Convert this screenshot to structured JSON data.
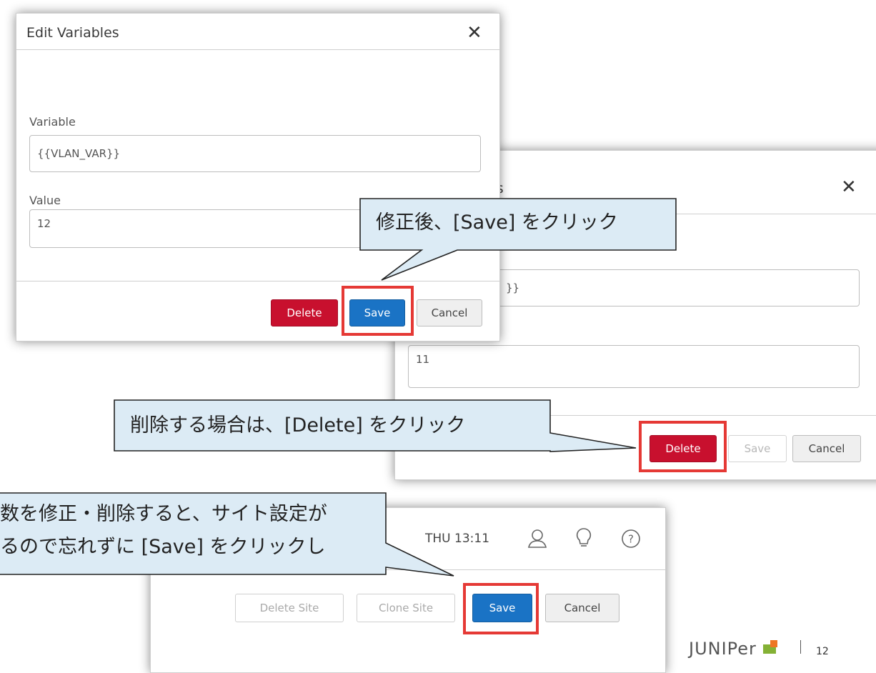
{
  "dialog_back": {
    "title_partial": "es",
    "variable_value_partial": "}}",
    "value": "11",
    "buttons": {
      "delete": "Delete",
      "save": "Save",
      "cancel": "Cancel"
    }
  },
  "dialog_front": {
    "title": "Edit Variables",
    "variable_label": "Variable",
    "variable_value": "{{VLAN_VAR}}",
    "value_label": "Value",
    "value": "12",
    "buttons": {
      "delete": "Delete",
      "save": "Save",
      "cancel": "Cancel"
    }
  },
  "site_panel": {
    "time": "THU 13:11",
    "buttons": {
      "delete_site": "Delete Site",
      "clone_site": "Clone Site",
      "save": "Save",
      "cancel": "Cancel"
    }
  },
  "callouts": {
    "save_dialog": "修正後、[Save] をクリック",
    "delete": "削除する場合は、[Delete] をクリック",
    "site_line1": "数を修正・削除すると、サイト設定が",
    "site_line2": "るので忘れずに [Save] をクリックし"
  },
  "footer": {
    "logo": "JUNIPer",
    "page_number": "12"
  },
  "colors": {
    "delete": "#c8102e",
    "save": "#1a73c5",
    "highlight": "#e53935",
    "callout_bg": "#dcebf5",
    "logo_green": "#84b135",
    "logo_orange": "#ee7623"
  }
}
